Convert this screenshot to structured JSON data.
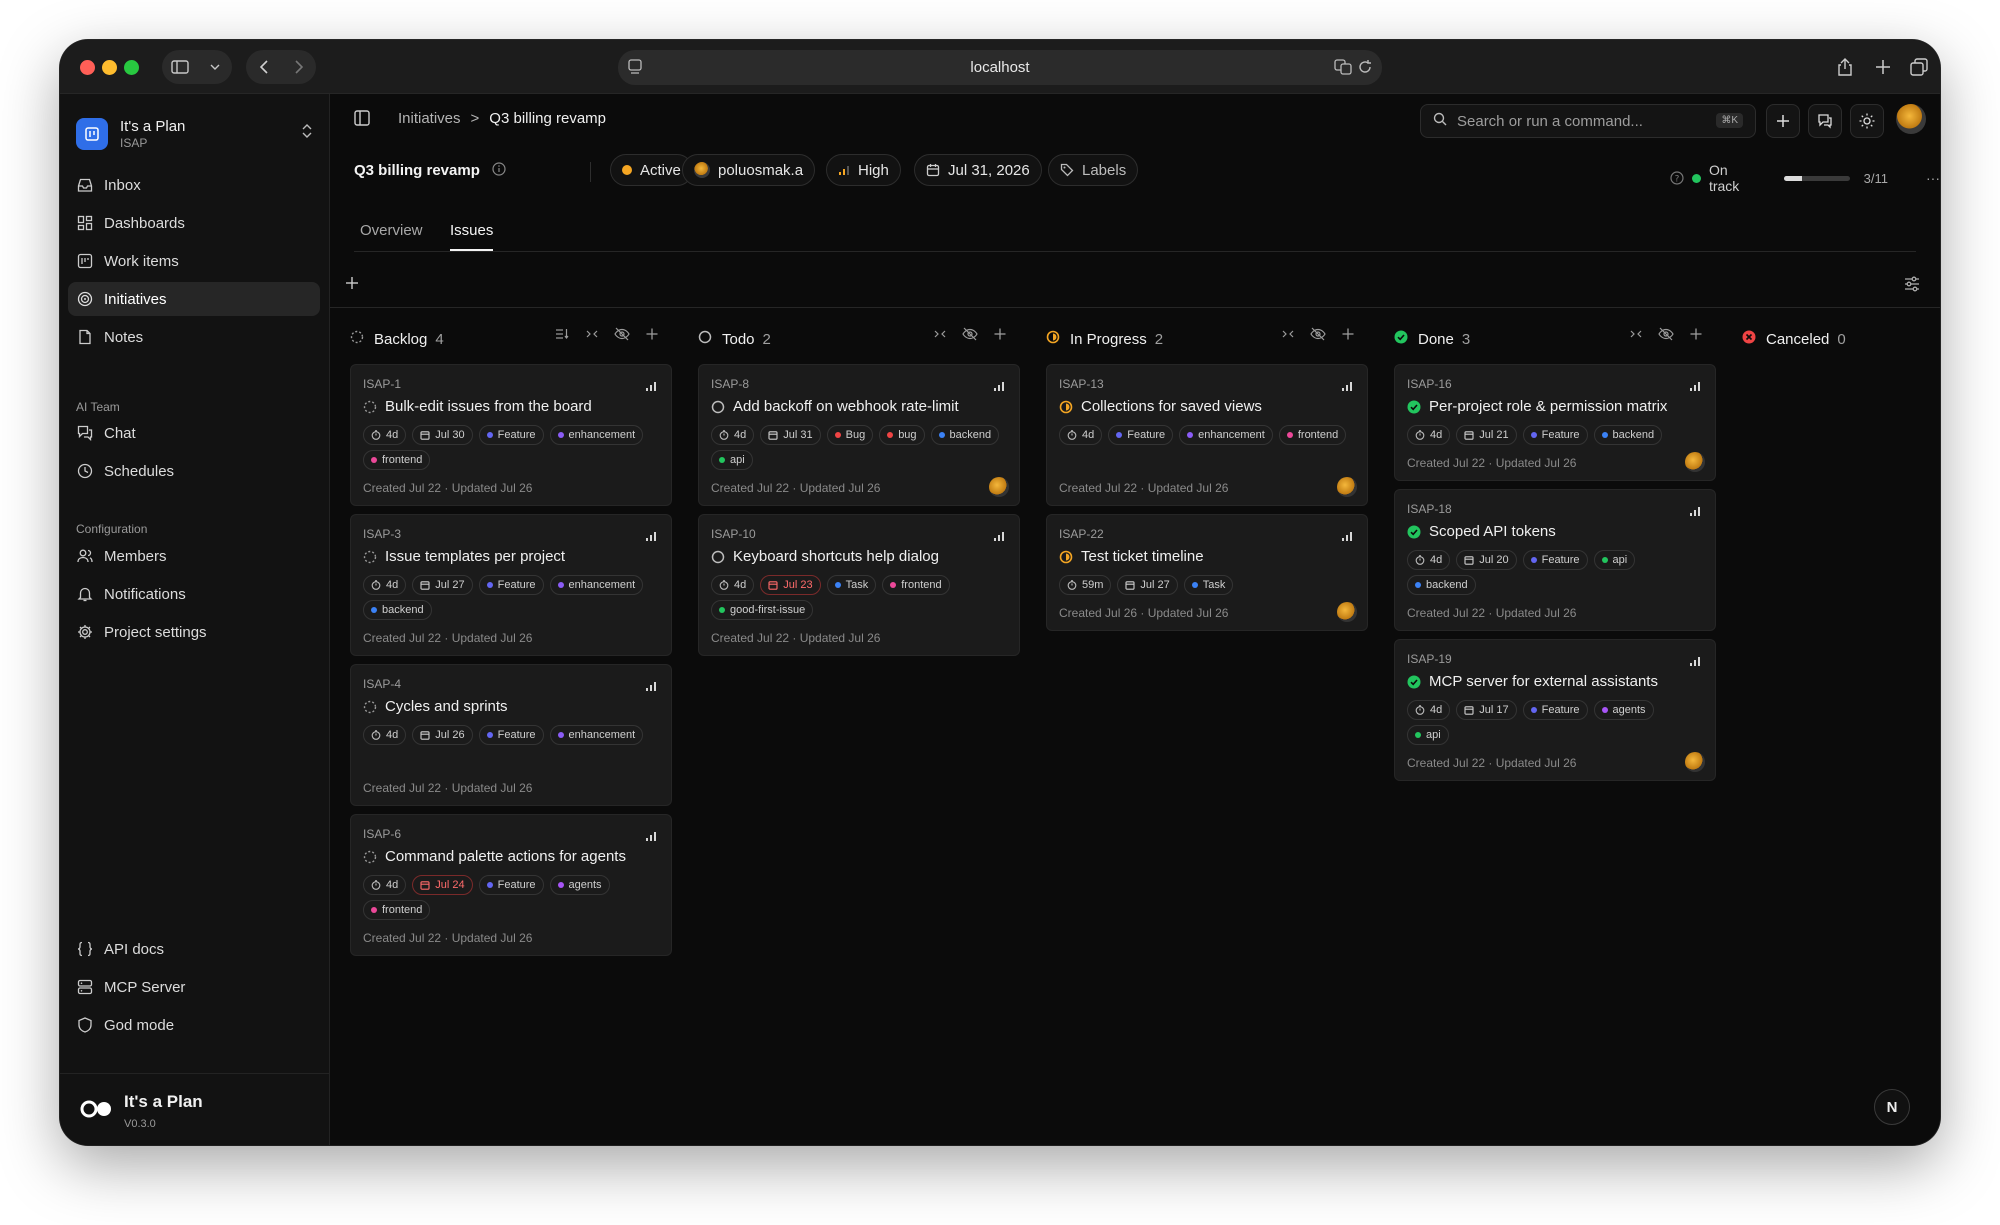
{
  "browser": {
    "url": "localhost"
  },
  "org": {
    "name": "It's a Plan",
    "key": "ISAP"
  },
  "nav": {
    "main": [
      {
        "label": "Inbox",
        "icon": "inbox-icon"
      },
      {
        "label": "Dashboards",
        "icon": "dashboard-icon"
      },
      {
        "label": "Work items",
        "icon": "work-items-icon"
      },
      {
        "label": "Initiatives",
        "icon": "target-icon",
        "active": true
      },
      {
        "label": "Notes",
        "icon": "notes-icon"
      }
    ],
    "ai_section": "AI Team",
    "ai": [
      {
        "label": "Chat",
        "icon": "chat-icon"
      },
      {
        "label": "Schedules",
        "icon": "clock-icon"
      }
    ],
    "config_section": "Configuration",
    "config": [
      {
        "label": "Members",
        "icon": "members-icon"
      },
      {
        "label": "Notifications",
        "icon": "bell-icon"
      },
      {
        "label": "Project settings",
        "icon": "gear-icon"
      }
    ],
    "bottom": [
      {
        "label": "API docs",
        "icon": "braces-icon"
      },
      {
        "label": "MCP Server",
        "icon": "server-icon"
      },
      {
        "label": "God mode",
        "icon": "shield-icon"
      }
    ]
  },
  "footer": {
    "brand": "It's a Plan",
    "version": "V0.3.0"
  },
  "breadcrumb": {
    "parent": "Initiatives",
    "separator": ">",
    "current": "Q3 billing revamp"
  },
  "search": {
    "placeholder": "Search or run a command...",
    "shortcut": "⌘K"
  },
  "project": {
    "title": "Q3 billing revamp",
    "status": "Active",
    "owner": "poluosmak.a",
    "priority": "High",
    "due": "Jul 31, 2026",
    "labels": "Labels",
    "health": "On track",
    "progress_text": "3/11",
    "progress_fraction": 0.27
  },
  "tabs": [
    {
      "label": "Overview"
    },
    {
      "label": "Issues",
      "active": true
    }
  ],
  "colors": {
    "accent": "#2f6ee8",
    "active": "#f5a623",
    "done": "#22c55e",
    "canceled": "#ef4444",
    "feature": "#6366f1",
    "enhancement": "#8b5cf6",
    "bug": "#ef4444",
    "frontend": "#ec4899",
    "backend": "#3b82f6",
    "api": "#22c55e",
    "agents": "#a855f7",
    "task": "#3b82f6",
    "good_first_issue": "#22c55e"
  },
  "columns": [
    {
      "name": "Backlog",
      "count": "4",
      "status": "backlog",
      "cards": [
        {
          "key": "ISAP-1",
          "title": "Bulk-edit issues from the board",
          "estimate": "4d",
          "date": "Jul 30",
          "overdue": false,
          "labels": [
            {
              "t": "Feature",
              "c": "#6366f1"
            },
            {
              "t": "enhancement",
              "c": "#8b5cf6"
            },
            {
              "t": "frontend",
              "c": "#ec4899"
            }
          ],
          "meta": "Created Jul 22 · Updated Jul 26",
          "avatar": false
        },
        {
          "key": "ISAP-3",
          "title": "Issue templates per project",
          "estimate": "4d",
          "date": "Jul 27",
          "overdue": false,
          "labels": [
            {
              "t": "Feature",
              "c": "#6366f1"
            },
            {
              "t": "enhancement",
              "c": "#8b5cf6"
            },
            {
              "t": "backend",
              "c": "#3b82f6"
            }
          ],
          "meta": "Created Jul 22 · Updated Jul 26",
          "avatar": false
        },
        {
          "key": "ISAP-4",
          "title": "Cycles and sprints",
          "estimate": "4d",
          "date": "Jul 26",
          "overdue": false,
          "labels": [
            {
              "t": "Feature",
              "c": "#6366f1"
            },
            {
              "t": "enhancement",
              "c": "#8b5cf6"
            }
          ],
          "meta": "Created Jul 22 · Updated Jul 26",
          "avatar": false
        },
        {
          "key": "ISAP-6",
          "title": "Command palette actions for agents",
          "estimate": "4d",
          "date": "Jul 24",
          "overdue": true,
          "labels": [
            {
              "t": "Feature",
              "c": "#6366f1"
            },
            {
              "t": "agents",
              "c": "#a855f7"
            },
            {
              "t": "frontend",
              "c": "#ec4899"
            }
          ],
          "meta": "Created Jul 22 · Updated Jul 26",
          "avatar": false
        }
      ]
    },
    {
      "name": "Todo",
      "count": "2",
      "status": "todo",
      "cards": [
        {
          "key": "ISAP-8",
          "title": "Add backoff on webhook rate-limit",
          "estimate": "4d",
          "date": "Jul 31",
          "overdue": false,
          "labels": [
            {
              "t": "Bug",
              "c": "#ef4444"
            },
            {
              "t": "bug",
              "c": "#ef4444"
            },
            {
              "t": "backend",
              "c": "#3b82f6"
            },
            {
              "t": "api",
              "c": "#22c55e"
            }
          ],
          "meta": "Created Jul 22 · Updated Jul 26",
          "avatar": true
        },
        {
          "key": "ISAP-10",
          "title": "Keyboard shortcuts help dialog",
          "estimate": "4d",
          "date": "Jul 23",
          "overdue": true,
          "labels": [
            {
              "t": "Task",
              "c": "#3b82f6"
            },
            {
              "t": "frontend",
              "c": "#ec4899"
            },
            {
              "t": "good-first-issue",
              "c": "#22c55e"
            }
          ],
          "meta": "Created Jul 22 · Updated Jul 26",
          "avatar": false
        }
      ]
    },
    {
      "name": "In Progress",
      "count": "2",
      "status": "in-progress",
      "cards": [
        {
          "key": "ISAP-13",
          "title": "Collections for saved views",
          "estimate": "4d",
          "date": null,
          "overdue": false,
          "labels": [
            {
              "t": "Feature",
              "c": "#6366f1"
            },
            {
              "t": "enhancement",
              "c": "#8b5cf6"
            },
            {
              "t": "frontend",
              "c": "#ec4899"
            }
          ],
          "meta": "Created Jul 22 · Updated Jul 26",
          "avatar": true
        },
        {
          "key": "ISAP-22",
          "title": "Test ticket timeline",
          "estimate": "59m",
          "date": "Jul 27",
          "overdue": false,
          "labels": [
            {
              "t": "Task",
              "c": "#3b82f6"
            }
          ],
          "meta": "Created Jul 26 · Updated Jul 26",
          "avatar": true
        }
      ]
    },
    {
      "name": "Done",
      "count": "3",
      "status": "done",
      "cards": [
        {
          "key": "ISAP-16",
          "title": "Per-project role & permission matrix",
          "estimate": "4d",
          "date": "Jul 21",
          "overdue": false,
          "labels": [
            {
              "t": "Feature",
              "c": "#6366f1"
            },
            {
              "t": "backend",
              "c": "#3b82f6"
            }
          ],
          "meta": "Created Jul 22 · Updated Jul 26",
          "avatar": true
        },
        {
          "key": "ISAP-18",
          "title": "Scoped API tokens",
          "estimate": "4d",
          "date": "Jul 20",
          "overdue": false,
          "labels": [
            {
              "t": "Feature",
              "c": "#6366f1"
            },
            {
              "t": "api",
              "c": "#22c55e"
            },
            {
              "t": "backend",
              "c": "#3b82f6"
            }
          ],
          "meta": "Created Jul 22 · Updated Jul 26",
          "avatar": false
        },
        {
          "key": "ISAP-19",
          "title": "MCP server for external assistants",
          "estimate": "4d",
          "date": "Jul 17",
          "overdue": false,
          "labels": [
            {
              "t": "Feature",
              "c": "#6366f1"
            },
            {
              "t": "agents",
              "c": "#a855f7"
            },
            {
              "t": "api",
              "c": "#22c55e"
            }
          ],
          "meta": "Created Jul 22 · Updated Jul 26",
          "avatar": true
        }
      ]
    },
    {
      "name": "Canceled",
      "count": "0",
      "status": "canceled",
      "cards": []
    }
  ],
  "fab_label": "N"
}
